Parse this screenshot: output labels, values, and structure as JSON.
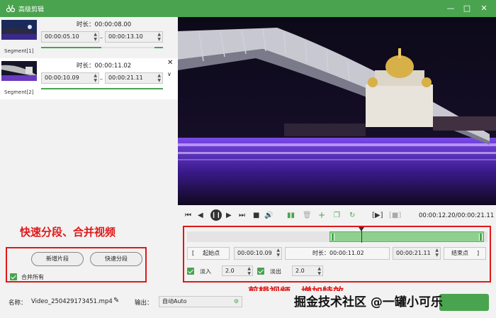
{
  "app": {
    "title": "高级剪辑"
  },
  "segments": [
    {
      "label": "Segment[1]",
      "duration_label": "时长：",
      "duration": "00:00:08.00",
      "start": "00:00:05.10",
      "end": "00:00:13.10"
    },
    {
      "label": "Segment[2]",
      "duration_label": "时长：",
      "duration": "00:00:11.02",
      "start": "00:00:10.09",
      "end": "00:00:21.11"
    }
  ],
  "left_actions": {
    "caption": "快速分段、合并视频",
    "add_segment": "新增片段",
    "quick_split": "快速分段",
    "merge_all": "合并所有"
  },
  "player": {
    "time": "00:00:12.20/00:00:21.11"
  },
  "editor": {
    "caption": "剪辑视频、增加特效",
    "start_label": "起始点",
    "start_value": "00:00:10.09",
    "duration_label": "时长：",
    "duration_value": "00:00:11.02",
    "end_value": "00:00:21.11",
    "end_label": "结束点",
    "fade_in_label": "淡入",
    "fade_in_value": "2.0",
    "fade_out_label": "淡出",
    "fade_out_value": "2.0"
  },
  "footer": {
    "name_label": "名称：",
    "file_name": "Video_250429173451.mp4",
    "output_label": "输出：",
    "output_value": "自动Auto"
  },
  "watermark": "掘金技术社区 @一罐小可乐",
  "colors": {
    "accent": "#4aa34e",
    "annotation_red": "#e01818"
  }
}
